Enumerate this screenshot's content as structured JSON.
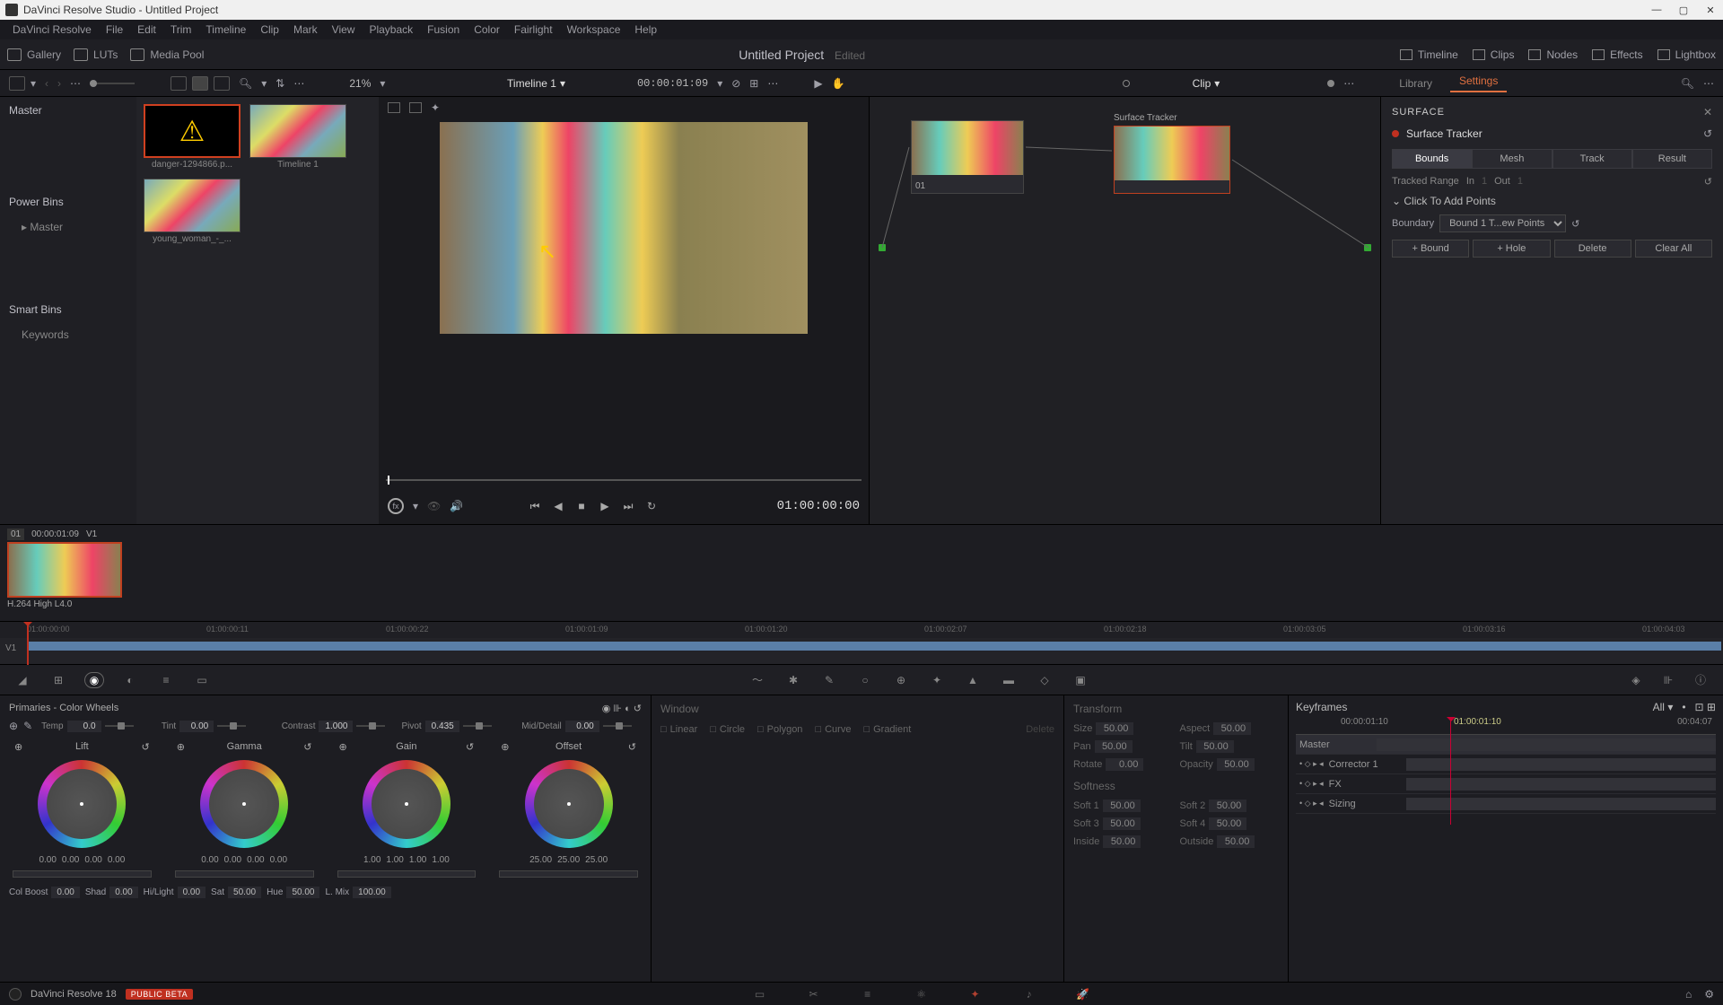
{
  "window": {
    "title": "DaVinci Resolve Studio - Untitled Project"
  },
  "menubar": [
    "DaVinci Resolve",
    "File",
    "Edit",
    "Trim",
    "Timeline",
    "Clip",
    "Mark",
    "View",
    "Playback",
    "Fusion",
    "Color",
    "Fairlight",
    "Workspace",
    "Help"
  ],
  "toolbar1": {
    "left": [
      "Gallery",
      "LUTs",
      "Media Pool"
    ],
    "project": "Untitled Project",
    "edited": "Edited",
    "right": [
      "Timeline",
      "Clips",
      "Nodes",
      "Effects",
      "Lightbox"
    ]
  },
  "toolbar2": {
    "zoom": "21%",
    "timeline": "Timeline 1",
    "tc": "00:00:01:09",
    "clip_label": "Clip",
    "tabs": {
      "library": "Library",
      "settings": "Settings"
    }
  },
  "left_panel": {
    "master": "Master",
    "powerbins": "Power Bins",
    "powerbins_master": "Master",
    "smartbins": "Smart Bins",
    "keywords": "Keywords"
  },
  "thumbs": [
    {
      "label": "danger-1294866.p..."
    },
    {
      "label": "Timeline 1"
    },
    {
      "label": "young_woman_-_..."
    }
  ],
  "transport": {
    "tc": "01:00:00:00"
  },
  "nodes": {
    "surface": "Surface Tracker",
    "n01": "01"
  },
  "tracker": {
    "title": "SURFACE",
    "name": "Surface Tracker",
    "tabs": [
      "Bounds",
      "Mesh",
      "Track",
      "Result"
    ],
    "range_lbl": "Tracked Range",
    "in": "In",
    "in_v": "1",
    "out": "Out",
    "out_v": "1",
    "section": "Click To Add Points",
    "boundary": "Boundary",
    "boundary_v": "Bound 1 T...ew Points",
    "btns": [
      "+ Bound",
      "+ Hole",
      "Delete",
      "Clear All"
    ]
  },
  "clip": {
    "num": "01",
    "tc": "00:00:01:09",
    "track": "V1",
    "codec": "H.264 High L4.0"
  },
  "timeline_ticks": [
    "01:00:00:00",
    "01:00:00:11",
    "01:00:00:22",
    "01:00:01:09",
    "01:00:01:20",
    "01:00:02:07",
    "01:00:02:18",
    "01:00:03:05",
    "01:00:03:16",
    "01:00:04:03"
  ],
  "timeline_track": "V1",
  "primaries": {
    "title": "Primaries - Color Wheels",
    "top": [
      {
        "lbl": "Temp",
        "val": "0.0"
      },
      {
        "lbl": "Tint",
        "val": "0.00"
      },
      {
        "lbl": "Contrast",
        "val": "1.000"
      },
      {
        "lbl": "Pivot",
        "val": "0.435"
      },
      {
        "lbl": "Mid/Detail",
        "val": "0.00"
      }
    ],
    "wheels": [
      {
        "name": "Lift",
        "vals": [
          "0.00",
          "0.00",
          "0.00",
          "0.00"
        ]
      },
      {
        "name": "Gamma",
        "vals": [
          "0.00",
          "0.00",
          "0.00",
          "0.00"
        ]
      },
      {
        "name": "Gain",
        "vals": [
          "1.00",
          "1.00",
          "1.00",
          "1.00"
        ]
      },
      {
        "name": "Offset",
        "vals": [
          "25.00",
          "25.00",
          "25.00"
        ]
      }
    ],
    "bottom": [
      {
        "lbl": "Col Boost",
        "val": "0.00"
      },
      {
        "lbl": "Shad",
        "val": "0.00"
      },
      {
        "lbl": "Hi/Light",
        "val": "0.00"
      },
      {
        "lbl": "Sat",
        "val": "50.00"
      },
      {
        "lbl": "Hue",
        "val": "50.00"
      },
      {
        "lbl": "L. Mix",
        "val": "100.00"
      }
    ]
  },
  "window_panel": {
    "title": "Window",
    "shapes": [
      "Linear",
      "Circle",
      "Polygon",
      "Curve",
      "Gradient"
    ],
    "delete": "Delete"
  },
  "transform": {
    "title": "Transform",
    "rows": [
      [
        {
          "lbl": "Size",
          "val": "50.00"
        },
        {
          "lbl": "Aspect",
          "val": "50.00"
        }
      ],
      [
        {
          "lbl": "Pan",
          "val": "50.00"
        },
        {
          "lbl": "Tilt",
          "val": "50.00"
        }
      ],
      [
        {
          "lbl": "Rotate",
          "val": "0.00"
        },
        {
          "lbl": "Opacity",
          "val": "50.00"
        }
      ]
    ],
    "soft_title": "Softness",
    "soft_rows": [
      [
        {
          "lbl": "Soft 1",
          "val": "50.00"
        },
        {
          "lbl": "Soft 2",
          "val": "50.00"
        }
      ],
      [
        {
          "lbl": "Soft 3",
          "val": "50.00"
        },
        {
          "lbl": "Soft 4",
          "val": "50.00"
        }
      ],
      [
        {
          "lbl": "Inside",
          "val": "50.00"
        },
        {
          "lbl": "Outside",
          "val": "50.00"
        }
      ]
    ]
  },
  "keyframes": {
    "title": "Keyframes",
    "all": "All",
    "tc_left": "00:00:01:10",
    "tc_mid": "01:00:01:10",
    "tc_right": "00:04:07",
    "tracks": [
      "Master",
      "Corrector 1",
      "FX",
      "Sizing"
    ]
  },
  "status": {
    "app": "DaVinci Resolve 18",
    "badge": "PUBLIC BETA"
  }
}
